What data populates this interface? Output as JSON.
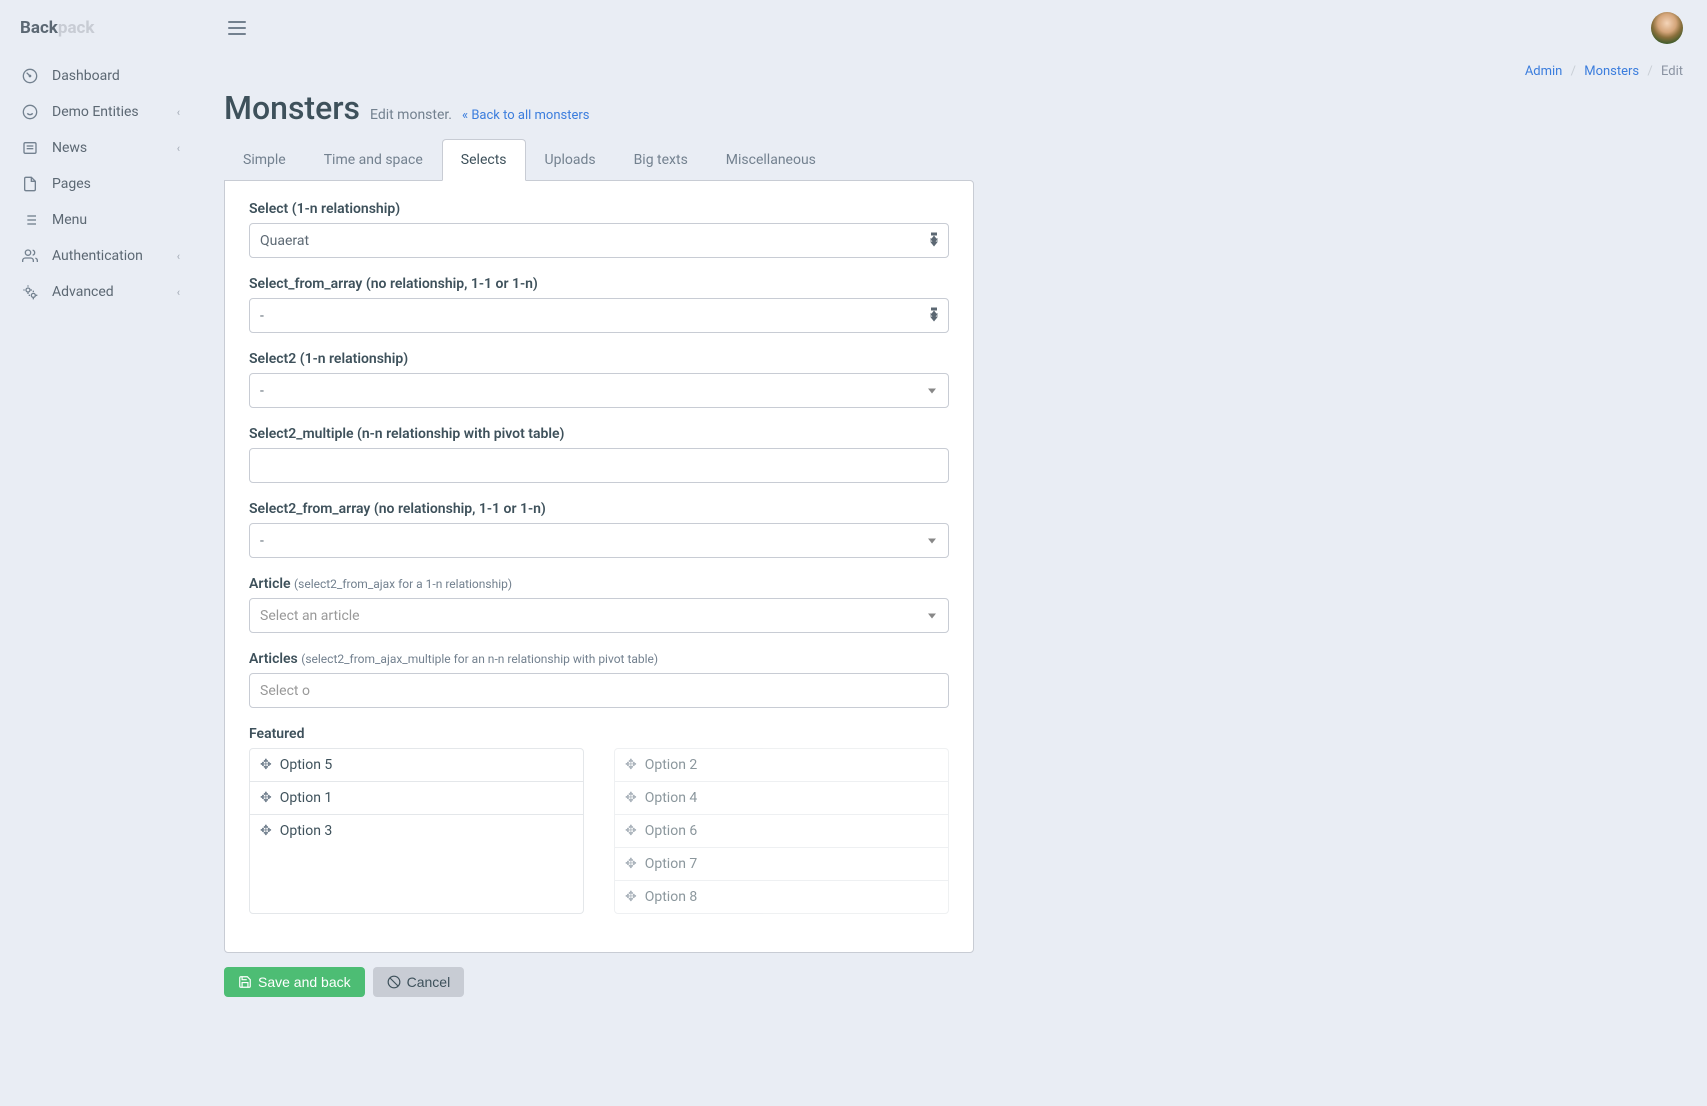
{
  "brand": {
    "a": "Back",
    "b": "pack"
  },
  "sidebar": {
    "items": [
      {
        "label": "Dashboard",
        "icon": "dashboard",
        "chev": false
      },
      {
        "label": "Demo Entities",
        "icon": "smile",
        "chev": true
      },
      {
        "label": "News",
        "icon": "news",
        "chev": true
      },
      {
        "label": "Pages",
        "icon": "file",
        "chev": false
      },
      {
        "label": "Menu",
        "icon": "list",
        "chev": false
      },
      {
        "label": "Authentication",
        "icon": "users",
        "chev": true
      },
      {
        "label": "Advanced",
        "icon": "cogs",
        "chev": true
      }
    ]
  },
  "breadcrumbs": {
    "a": "Admin",
    "b": "Monsters",
    "c": "Edit"
  },
  "header": {
    "title": "Monsters",
    "sub": "Edit monster.",
    "back": "Back to all monsters"
  },
  "tabs": [
    "Simple",
    "Time and space",
    "Selects",
    "Uploads",
    "Big texts",
    "Miscellaneous"
  ],
  "fields": {
    "f1": {
      "label": "Select (1-n relationship)",
      "value": "Quaerat"
    },
    "f2": {
      "label": "Select_from_array (no relationship, 1-1 or 1-n)",
      "value": "-"
    },
    "f3": {
      "label": "Select2 (1-n relationship)",
      "value": "-"
    },
    "f4": {
      "label": "Select2_multiple (n-n relationship with pivot table)",
      "value": ""
    },
    "f5": {
      "label": "Select2_from_array (no relationship, 1-1 or 1-n)",
      "value": "-"
    },
    "f6": {
      "label": "Article",
      "hint": "(select2_from_ajax for a 1-n relationship)",
      "placeholder": "Select an article"
    },
    "f7": {
      "label": "Articles",
      "hint": "(select2_from_ajax_multiple for an n-n relationship with pivot table)",
      "placeholder": "Select o"
    },
    "f8": {
      "label": "Featured"
    }
  },
  "featured": {
    "left": [
      "Option 5",
      "Option 1",
      "Option 3"
    ],
    "right": [
      "Option 2",
      "Option 4",
      "Option 6",
      "Option 7",
      "Option 8"
    ]
  },
  "buttons": {
    "save": "Save and back",
    "cancel": "Cancel"
  }
}
